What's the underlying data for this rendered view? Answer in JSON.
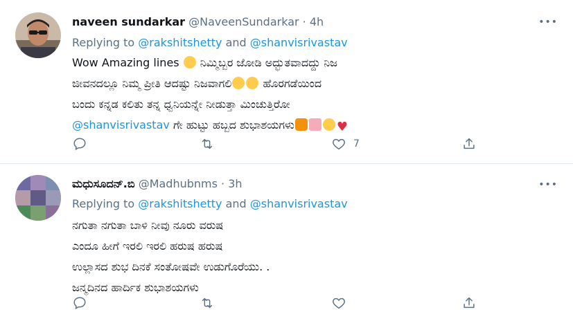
{
  "tweets": [
    {
      "name": "naveen sundarkar",
      "handle": "@NaveenSundarkar",
      "separator": "·",
      "time": "4h",
      "replying_prefix": "Replying to ",
      "replying_user1": "@rakshitshetty",
      "replying_and": " and ",
      "replying_user2": "@shanvisrivastav",
      "line1_a": "Wow Amazing lines ",
      "line1_b": " ನಿಮ್ಮಿಬ್ಬರ ಜೋಡಿ ಅದ್ಭುತವಾದದ್ದು ನಿಜ",
      "line2_a": "ಜೀವನದಲ್ಲೂ ನಿಮ್ಮ ಪ್ರೀತಿ ಆದಷ್ಟು ನಿಜವಾಗಲಿ",
      "line2_b": " ಹೊರಗಡೆಯಿಂದ",
      "line3": "ಬಂದು ಕನ್ನಡ ಕಲಿತು ತನ್ನ ಧ್ವನಿಯನ್ನೇ ನೀಡುತ್ತಾ ಮಿಂಚುತ್ತಿರೋ",
      "line4_mention": "@shanvisrivastav",
      "line4_text": " ಗೇ ಹುಟ್ಟು ಹಬ್ಬದ ಶುಭಾಶಯಗಳು",
      "like_count": "7",
      "icons": [
        "reply-icon",
        "retweet-icon",
        "like-icon",
        "share-icon"
      ]
    },
    {
      "name": "ಮಧುಸೂದನ್.ಬಿ",
      "handle": "@Madhubnms",
      "separator": "·",
      "time": "3h",
      "replying_prefix": "Replying to ",
      "replying_user1": "@rakshitshetty",
      "replying_and": " and ",
      "replying_user2": "@shanvisrivastav",
      "lines": [
        "ನಗುತಾ ನಗುತಾ ಬಾಳಿ ನೀವು ನೂರು ವರುಷ",
        "ಎಂದೂ ಹೀಗೆ ಇರಲಿ ಇರಲಿ ಹರುಷ ಹರುಷ",
        "ಉಲ್ಲಾಸದ ಶುಭ ದಿನಕೆ ಸಂತೋಷವೇ ಉಡುಗೊರೆಯು. .",
        "ಜನ್ಮದಿನದ ಹಾರ್ದಿಕ ಶುಭಾಶಯಗಳು"
      ]
    }
  ],
  "more_label": "•••",
  "colors": {
    "link": "#1b95e0",
    "secondary": "#5b7083",
    "divider": "#e1e8ed"
  }
}
